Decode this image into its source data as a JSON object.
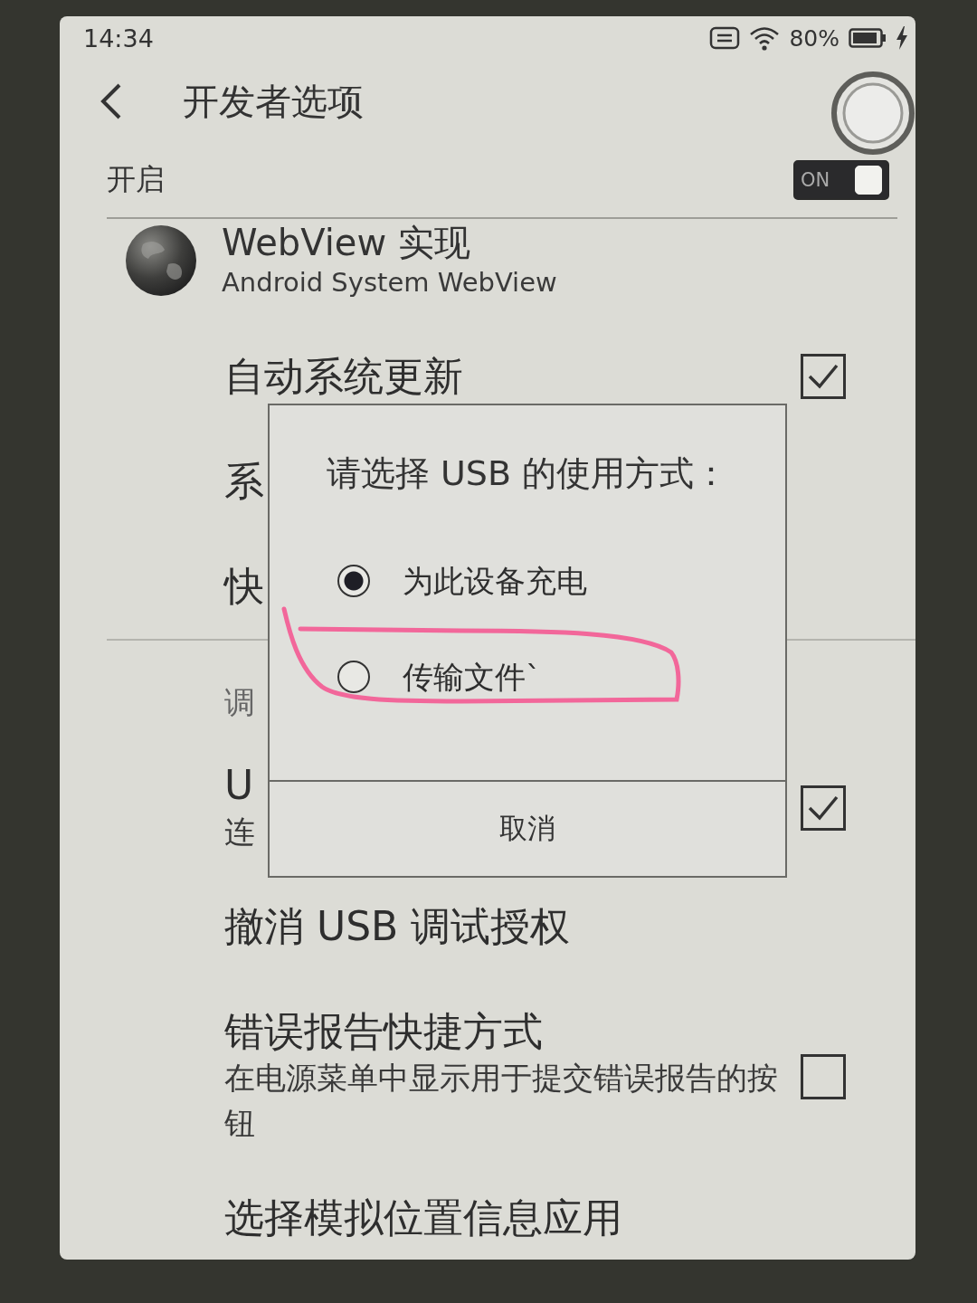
{
  "status_bar": {
    "time": "14:34",
    "battery": "80%"
  },
  "header": {
    "title": "开发者选项"
  },
  "master_switch": {
    "label": "开启",
    "state_text": "ON",
    "on": true
  },
  "settings": [
    {
      "kind": "app",
      "title": "WebView 实现",
      "summary": "Android System WebView"
    },
    {
      "kind": "checkbox",
      "title": "自动系统更新",
      "checked": true
    },
    {
      "kind": "plain",
      "title": "系"
    },
    {
      "kind": "plain",
      "title": "快"
    },
    {
      "kind": "category",
      "title": "调"
    },
    {
      "kind": "checkbox",
      "title": "U",
      "summary": "连",
      "checked": true
    },
    {
      "kind": "plain",
      "title": "撤消 USB 调试授权"
    },
    {
      "kind": "checkbox",
      "title": "错误报告快捷方式",
      "summary": "在电源菜单中显示用于提交错误报告的按钮",
      "checked": false
    },
    {
      "kind": "plain",
      "title": "选择模拟位置信息应用"
    }
  ],
  "dialog": {
    "title": "请选择 USB 的使用方式：",
    "options": [
      {
        "label": "为此设备充电",
        "selected": true,
        "annotated": false
      },
      {
        "label": "传输文件`",
        "selected": false,
        "annotated": true
      }
    ],
    "button": "取消"
  }
}
